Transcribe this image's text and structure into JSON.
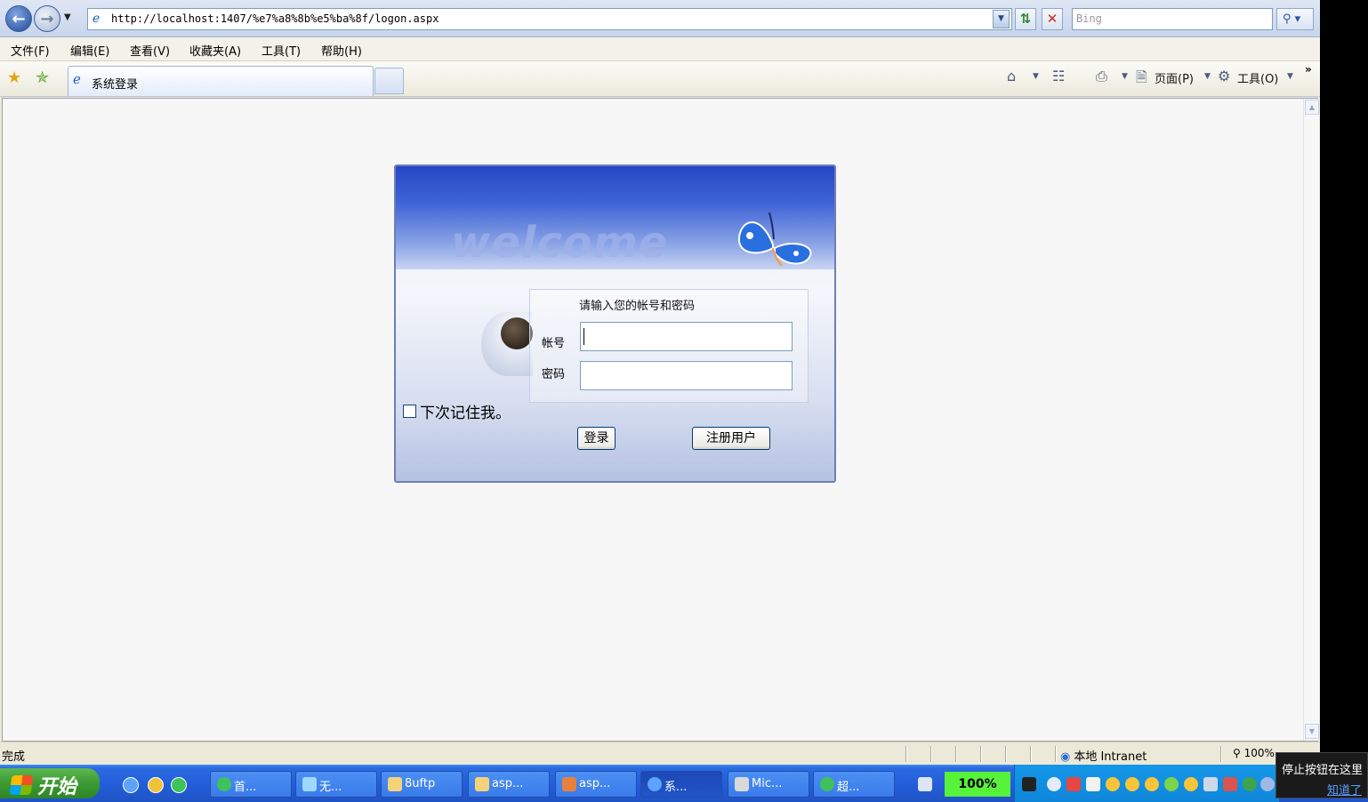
{
  "browser": {
    "url": "http://localhost:1407/%e7%a8%8b%e5%ba%8f/logon.aspx",
    "search_placeholder": "Bing",
    "menu": [
      "文件(F)",
      "编辑(E)",
      "查看(V)",
      "收藏夹(A)",
      "工具(T)",
      "帮助(H)"
    ],
    "tab_title": "系统登录",
    "commands": {
      "page": "页面(P)",
      "tools": "工具(O)"
    },
    "status_text": "完成",
    "zone": "本地 Intranet",
    "zoom": "100%"
  },
  "login": {
    "banner_text": "welcome",
    "prompt": "请输入您的帐号和密码",
    "account_label": "帐号",
    "password_label": "密码",
    "account_value": "",
    "password_value": "",
    "remember_label": "下次记住我。",
    "login_button": "登录",
    "register_button": "注册用户"
  },
  "taskbar": {
    "start_label": "开始",
    "tasks": [
      "首...",
      "无...",
      "8uftp",
      "asp...",
      "asp...",
      "系...",
      "Mic...",
      "超..."
    ],
    "active_task_index": 5,
    "battery_label": "100%",
    "tooltip_text": "停止按钮在这里",
    "tooltip_link": "知道了"
  }
}
